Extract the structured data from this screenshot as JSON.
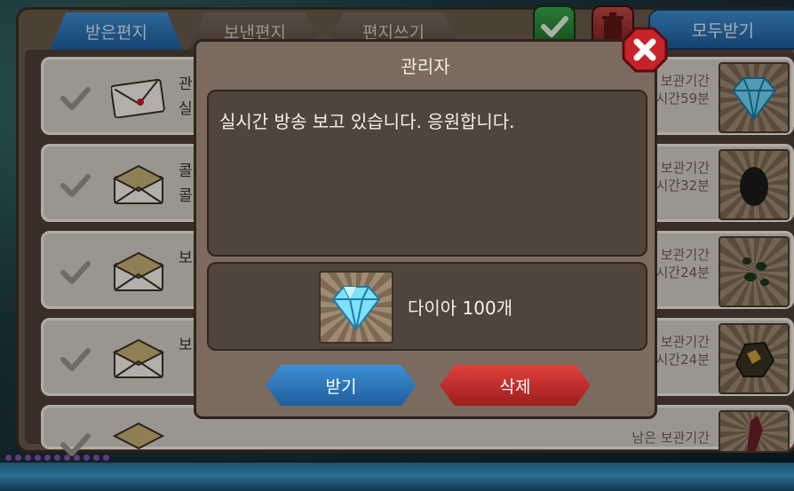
{
  "tabs": [
    {
      "label": "받은편지",
      "active": true
    },
    {
      "label": "보낸편지",
      "active": false
    },
    {
      "label": "편지쓰기",
      "active": false
    }
  ],
  "toolbar": {
    "check_all_icon": "check-icon",
    "delete_all_icon": "trash-icon",
    "receive_all_label": "모두받기"
  },
  "mail_list": [
    {
      "line1": "관",
      "line2": "실",
      "expire_label": "보관기간",
      "expire_time": "시간59분",
      "item_icon": "diamond-icon",
      "read": false
    },
    {
      "line1": "콜",
      "line2": "콜",
      "expire_label": "보관기간",
      "expire_time": "시간32분",
      "item_icon": "egg-icon",
      "read": true
    },
    {
      "line1": "",
      "line2": "보",
      "expire_label": "보관기간",
      "expire_time": "시간24분",
      "item_icon": "stones-icon",
      "read": true
    },
    {
      "line1": "",
      "line2": "보",
      "expire_label": "보관기간",
      "expire_time": "시간24분",
      "item_icon": "ore-icon",
      "read": true
    },
    {
      "line1": "",
      "line2": "",
      "expire_label": "남은 보관기간",
      "expire_time": "",
      "item_icon": "crystal-icon",
      "read": true
    }
  ],
  "modal": {
    "title": "관리자",
    "message": "실시간 방송 보고 있습니다. 응원합니다.",
    "reward": {
      "icon": "diamond-icon",
      "text": "다이아 100개"
    },
    "receive_label": "받기",
    "delete_label": "삭제",
    "close_icon": "close-icon"
  },
  "colors": {
    "accent_blue": "#2e78c0",
    "danger_red": "#d23333",
    "panel_brown": "#7b6b5e"
  }
}
